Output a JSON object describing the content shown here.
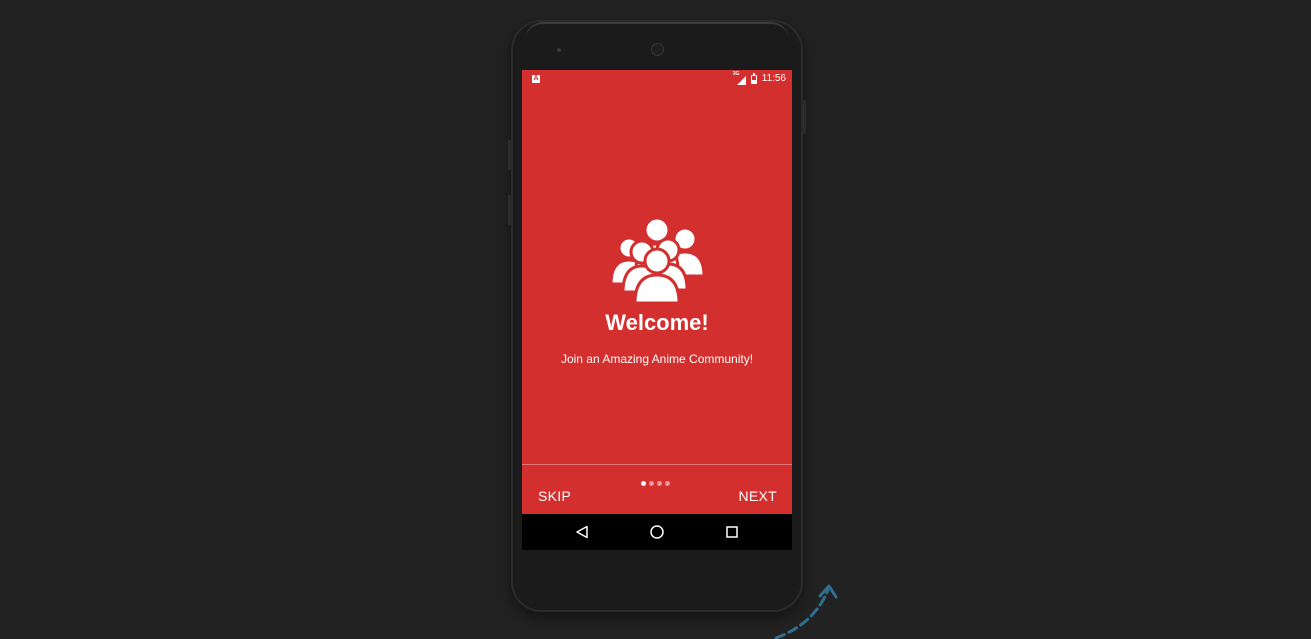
{
  "status_bar": {
    "app_icon": "A",
    "network_type": "3G",
    "time": "11:56"
  },
  "icons": {
    "hero": "people-group-icon",
    "back": "back-triangle-icon",
    "home": "home-circle-icon",
    "recents": "recents-square-icon",
    "arrow": "curved-arrow-icon"
  },
  "onboarding": {
    "title": "Welcome!",
    "subtitle": "Join an Amazing Anime Community!",
    "page_count": 4,
    "current_page": 1
  },
  "footer": {
    "skip_label": "SKIP",
    "next_label": "NEXT"
  },
  "colors": {
    "screen_background": "#d32f2f",
    "desktop_background": "#222222",
    "text": "#ffffff",
    "arrow": "#2e6f8f"
  }
}
